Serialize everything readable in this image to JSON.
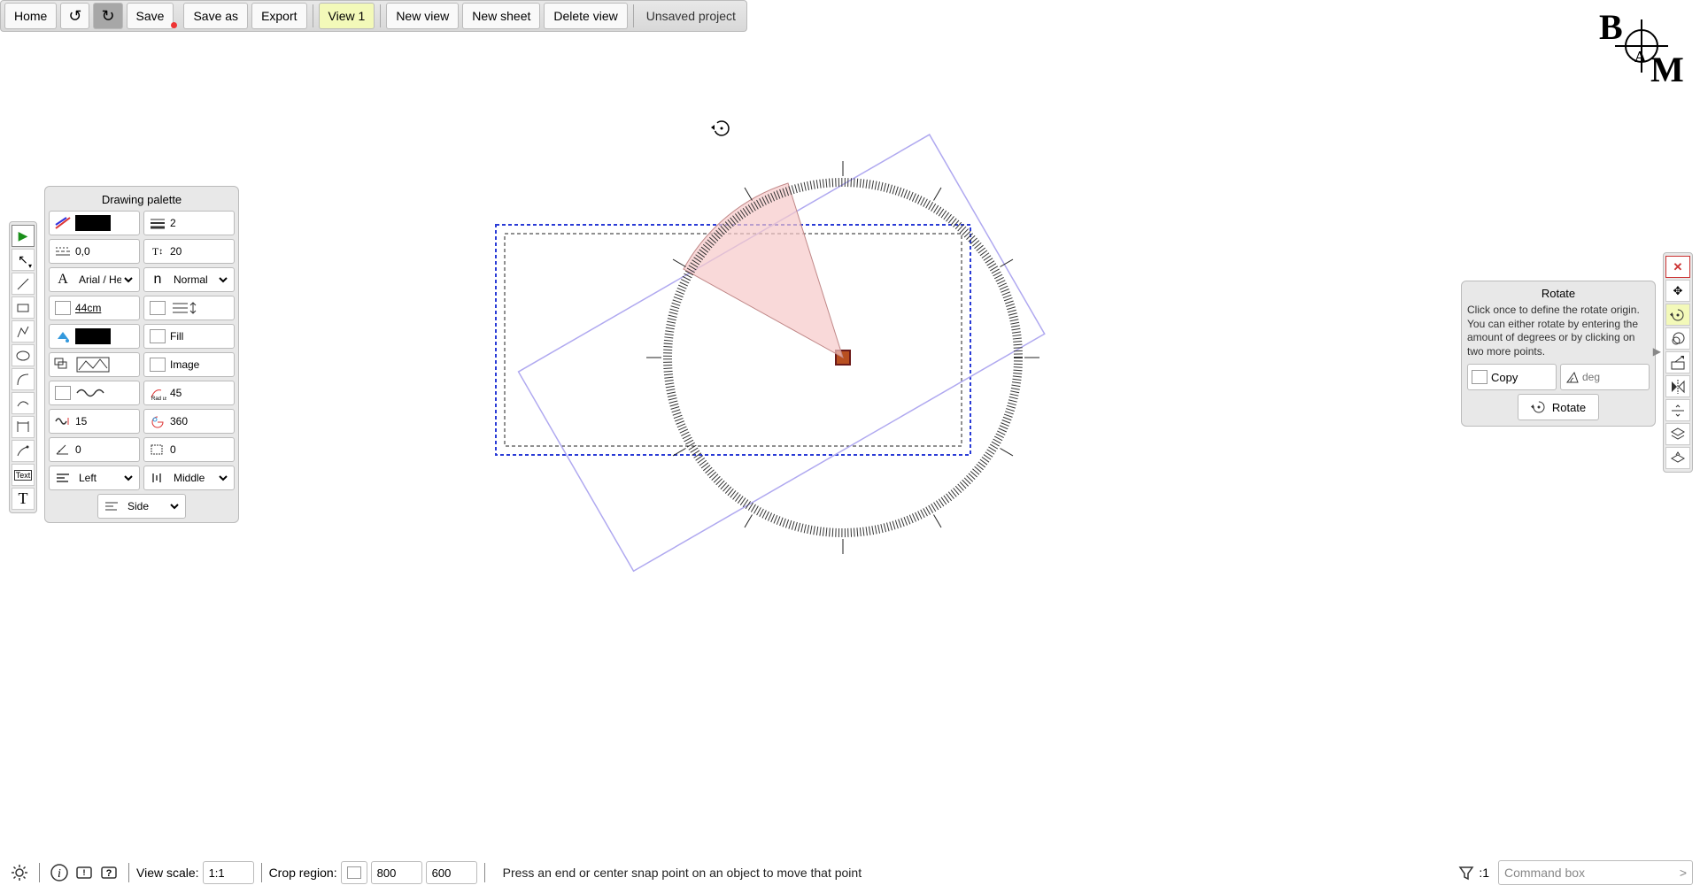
{
  "toolbar": {
    "home": "Home",
    "save": "Save",
    "save_as": "Save as",
    "export": "Export",
    "view1": "View 1",
    "new_view": "New view",
    "new_sheet": "New sheet",
    "delete_view": "Delete view",
    "unsaved": "Unsaved project"
  },
  "drawing_palette": {
    "title": "Drawing palette",
    "line_width": "2",
    "dash": "0,0",
    "text_size": "20",
    "font": "Arial / Helvetica",
    "style": "Normal",
    "scale_text": "44cm",
    "fill_label": "Fill",
    "image_label": "Image",
    "sine_phase": "45",
    "sine_freq": "15",
    "angle_360": "360",
    "offset1": "0",
    "offset2": "0",
    "align": "Left",
    "valign": "Middle",
    "side": "Side"
  },
  "rotate_panel": {
    "title": "Rotate",
    "desc": "Click once to define the rotate origin. You can either rotate by entering the amount of degrees or by clicking on two more points.",
    "copy_label": "Copy",
    "deg_placeholder": "deg",
    "rotate_button": "Rotate"
  },
  "status": {
    "view_scale_label": "View scale:",
    "view_scale_value": "1:1",
    "crop_region_label": "Crop region:",
    "crop_w": "800",
    "crop_h": "600",
    "message": "Press an end or center snap point on an object to move that point",
    "funnel_value": ":1",
    "command_placeholder": "Command box",
    "command_caret": ">"
  }
}
